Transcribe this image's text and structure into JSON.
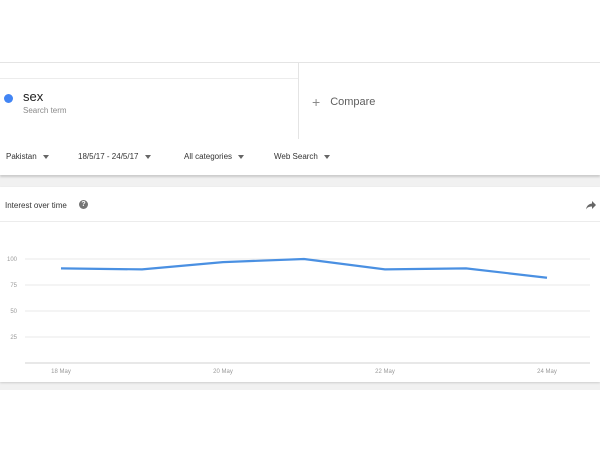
{
  "search": {
    "term": "sex",
    "term_sub": "Search term",
    "term_color": "#4285f4",
    "compare_label": "Compare"
  },
  "filters": {
    "region": "Pakistan",
    "date_range": "18/5/17 - 24/5/17",
    "category": "All categories",
    "search_type": "Web Search"
  },
  "card": {
    "title": "Interest over time",
    "help_icon": "help-icon",
    "share_icon": "share-icon"
  },
  "chart_data": {
    "type": "line",
    "x": [
      "18 May",
      "19 May",
      "20 May",
      "21 May",
      "22 May",
      "23 May",
      "24 May"
    ],
    "x_tick_labels": [
      "18 May",
      "20 May",
      "22 May",
      "24 May"
    ],
    "series": [
      {
        "values": [
          91,
          90,
          97,
          100,
          90,
          91,
          82
        ],
        "color": "#4a90e2"
      }
    ],
    "ylim": [
      0,
      100
    ],
    "y_ticks": [
      25,
      50,
      75,
      100
    ],
    "grid": true
  }
}
